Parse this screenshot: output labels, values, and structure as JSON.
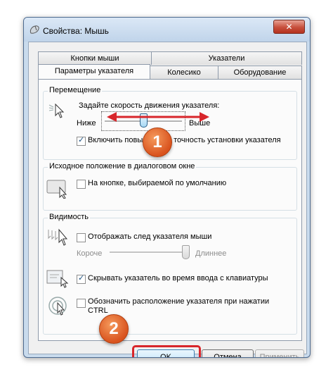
{
  "window": {
    "title": "Свойства: Мышь",
    "close_label": "✕"
  },
  "tabs_row1": [
    "Кнопки мыши",
    "Указатели"
  ],
  "tabs_row2": [
    "Параметры указателя",
    "Колесико",
    "Оборудование"
  ],
  "movement": {
    "group_label": "Перемещение",
    "speed_label": "Задайте скорость движения указателя:",
    "slow_label": "Ниже",
    "fast_label": "Выше",
    "speed_level": 0.5,
    "precision_label": "Включить повышенную точность установки указателя",
    "precision_checked": true
  },
  "snap": {
    "group_label": "Исходное положение в диалоговом окне",
    "snap_label": "На кнопке, выбираемой по умолчанию",
    "snap_checked": false
  },
  "visibility": {
    "group_label": "Видимость",
    "trails_label": "Отображать след указателя мыши",
    "trails_checked": false,
    "short_label": "Короче",
    "long_label": "Длиннее",
    "trail_level": 1.0,
    "hide_label": "Скрывать указатель во время ввода с клавиатуры",
    "hide_checked": true,
    "ctrl_label": "Обозначить расположение указателя при нажатии CTRL",
    "ctrl_checked": false
  },
  "buttons": {
    "ok": "OK",
    "cancel": "Отмена",
    "apply": "Применить"
  },
  "callouts": [
    "1",
    "2"
  ],
  "colors": {
    "highlight": "#d8262b",
    "callout": "#e05a1d"
  }
}
